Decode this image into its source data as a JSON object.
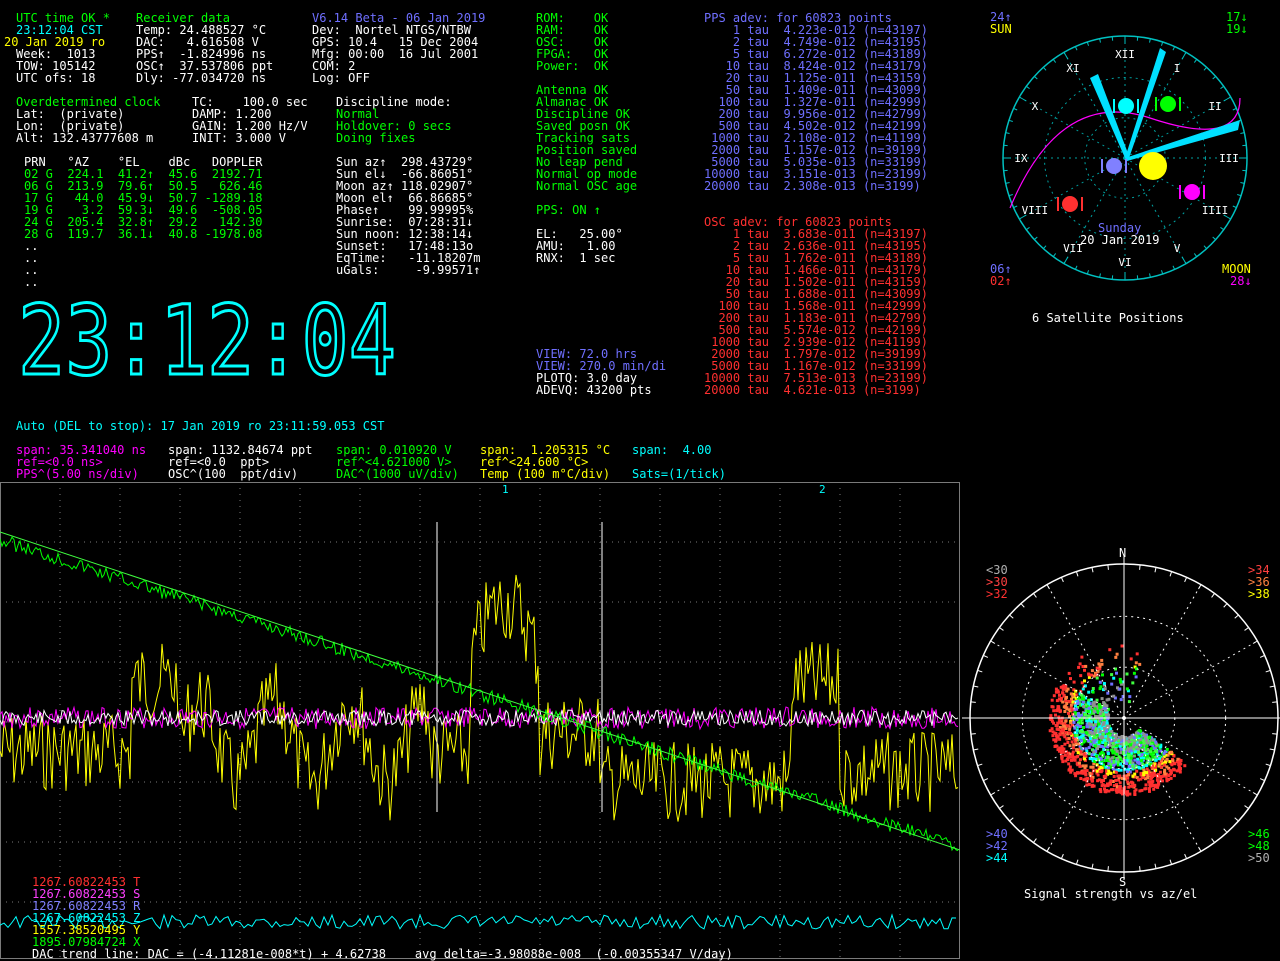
{
  "status": {
    "utc_ok": "UTC time OK *",
    "receiver": "Receiver data",
    "time_line": "23:12:04 CST",
    "temp_line": "Temp: 24.488527 °C",
    "date_line": "20 Jan 2019 ro",
    "dac_line": "DAC:   4.616508 V",
    "week_line": "Week:  1013",
    "pps_line": "PPS↑  -1.824996 ns",
    "tow_line": "TOW: 105142",
    "osc_line": "OSC↑  37.537806 ppt",
    "utcofs_line": "UTC ofs: 18",
    "dly_line": "Dly: -77.034720 ns"
  },
  "device": {
    "version": "V6.14 Beta - 06 Jan 2019",
    "dev": "Dev:  Nortel NTGS/NTBW",
    "gps": "GPS: 10.4   15 Dec 2004",
    "mfg": "Mfg: 00:00  16 Jul 2001",
    "com": "COM: 2",
    "log": "Log: OFF"
  },
  "health": {
    "lines": [
      "ROM:    OK",
      "RAM:    OK",
      "OSC:    OK",
      "FPGA:   OK",
      "Power:  OK"
    ],
    "flags": [
      "Antenna OK",
      "Almanac OK",
      "Discipline OK",
      "Saved posn OK",
      "Tracking sats",
      "Position saved",
      "No leap pend",
      "Normal op mode",
      "Normal OSC age"
    ],
    "pps_on": "PPS: ON ↑",
    "el": "EL:   25.00°",
    "amu": "AMU:   1.00",
    "rnx": "RNX:  1 sec"
  },
  "clock": {
    "mode": "Overdetermined clock",
    "tc": "TC:    100.0 sec",
    "lat": "Lat:  (private)",
    "damp": "DAMP: 1.200",
    "lon": "Lon:  (private)",
    "gain": "GAIN: 1.200 Hz/V",
    "alt": "Alt: 132.43777608 m",
    "init": "INIT: 3.000 V",
    "discipline_label": "Discipline mode:",
    "discipline_lines": [
      "Normal",
      "Holdover: 0 secs",
      "Doing fixes"
    ]
  },
  "sat_table": {
    "header": "PRN   °AZ    °EL    dBc   DOPPLER",
    "rows": [
      "02 G  224.1  41.2↑  45.6  2192.71",
      "06 G  213.9  79.6↑  50.5   626.46",
      "17 G   44.0  45.9↓  50.7 -1289.18",
      "19 G    3.2  59.3↓  49.6  -508.05",
      "24 G  205.4  32.8↑  29.2   142.30",
      "28 G  119.7  36.1↓  40.8 -1978.08"
    ],
    "dots": [
      "..",
      "..",
      "..",
      ".."
    ]
  },
  "sun": [
    "Sun az↑  298.43729°",
    "Sun el↓  -66.86051°",
    "Moon az↑ 118.02907°",
    "Moon el↑  66.86685°",
    "Phase↑    99.99995%",
    "Sunrise:  07:28:31↓",
    "Sun noon: 12:38:14↓",
    "Sunset:   17:48:13o",
    "EqTime:   -11.18207m",
    "uGals:     -9.99571↑"
  ],
  "big_clock": "23:12:04",
  "view": {
    "view1": "VIEW: 72.0 hrs",
    "view2": "VIEW: 270.0 min/di",
    "plotq": "PLOTQ: 3.0 day",
    "adevq": "ADEVQ: 43200 pts"
  },
  "pps_adev": {
    "title": "PPS adev: for 60823 points",
    "rows": [
      "    1 tau  4.223e-012 (n=43197)",
      "    2 tau  4.749e-012 (n=43195)",
      "    5 tau  6.272e-012 (n=43189)",
      "   10 tau  8.424e-012 (n=43179)",
      "   20 tau  1.125e-011 (n=43159)",
      "   50 tau  1.409e-011 (n=43099)",
      "  100 tau  1.327e-011 (n=42999)",
      "  200 tau  9.956e-012 (n=42799)",
      "  500 tau  4.502e-012 (n=42199)",
      " 1000 tau  2.108e-012 (n=41199)",
      " 2000 tau  1.157e-012 (n=39199)",
      " 5000 tau  5.035e-013 (n=33199)",
      "10000 tau  3.151e-013 (n=23199)",
      "20000 tau  2.308e-013 (n=3199)"
    ]
  },
  "osc_adev": {
    "title": "OSC adev: for 60823 points",
    "rows": [
      "    1 tau  3.683e-011 (n=43197)",
      "    2 tau  2.636e-011 (n=43195)",
      "    5 tau  1.762e-011 (n=43189)",
      "   10 tau  1.466e-011 (n=43179)",
      "   20 tau  1.502e-011 (n=43159)",
      "   50 tau  1.688e-011 (n=43099)",
      "  100 tau  1.568e-011 (n=42999)",
      "  200 tau  1.183e-011 (n=42799)",
      "  500 tau  5.574e-012 (n=42199)",
      " 1000 tau  2.939e-012 (n=41199)",
      " 2000 tau  1.797e-012 (n=39199)",
      " 5000 tau  1.167e-012 (n=33199)",
      "10000 tau  7.513e-013 (n=23199)",
      "20000 tau  4.621e-013 (n=3199)"
    ]
  },
  "auto_line": "Auto (DEL to stop): 17 Jan 2019 ro 23:11:59.053 CST",
  "legend": {
    "span_pps": "span: 35.341040 ns",
    "span_osc": "span: 1132.84674 ppt",
    "span_dac": "span: 0.010920 V",
    "span_temp": "span:  1.205315 °C",
    "span_sats": "span:  4.00",
    "ref_pps": "ref=<0.0 ns>",
    "ref_osc": "ref=<0.0  ppt>",
    "ref_dac": "ref^<4.621000 V>",
    "ref_temp": "ref^<24.600 °C>",
    "div_pps": "PPS^(5.00 ns/div)",
    "div_osc": "OSC^(100  ppt/div)",
    "div_dac": "DAC^(1000 uV/div)",
    "div_temp": "Temp (100 m°C/div)",
    "div_sats": "Sats=(1/tick)"
  },
  "plot_markers": [
    "1",
    "2"
  ],
  "plot_values": [
    {
      "text": "1267.60822453 T",
      "color": "#ff3030"
    },
    {
      "text": "1267.60822453 S",
      "color": "#ff40ff"
    },
    {
      "text": "1267.60822453 R",
      "color": "#8080ff"
    },
    {
      "text": "1267.60822453 Z",
      "color": "#00ffff"
    },
    {
      "text": "1557.38520495 Y",
      "color": "#ffff00"
    },
    {
      "text": "1895.07984724 X",
      "color": "#00ff00"
    }
  ],
  "trend_line": "DAC trend line: DAC = (-4.11281e-008*t) + 4.62738    avg delta=-3.98088e-008  (-0.00355347 V/day)",
  "sky": {
    "caption": "6 Satellite Positions",
    "hours": [
      "XII",
      "I",
      "II",
      "III",
      "IIII",
      "V",
      "VI",
      "VII",
      "VIII",
      "IX",
      "X",
      "XI"
    ],
    "day": "Sunday",
    "date": "20 Jan 2019",
    "tl": "24↑",
    "tl2": "SUN",
    "tr": "17↓",
    "tr2": "19↓",
    "bl": "06↑",
    "bl2": "02↑",
    "br": "MOON",
    "br2": "28↓"
  },
  "signal": {
    "caption": "Signal strength vs az/el",
    "north": "N",
    "south": "S",
    "left_top": [
      {
        "t": "<30",
        "c": "#b0b0b0"
      },
      {
        "t": ">30",
        "c": "#ff4040"
      },
      {
        "t": ">32",
        "c": "#ff3030"
      }
    ],
    "right_top": [
      {
        "t": ">34",
        "c": "#ff4040"
      },
      {
        "t": ">36",
        "c": "#ff8040"
      },
      {
        "t": ">38",
        "c": "#ffff00"
      }
    ],
    "left_bot": [
      {
        "t": ">40",
        "c": "#6f6fff"
      },
      {
        "t": ">42",
        "c": "#6f6fff"
      },
      {
        "t": ">44",
        "c": "#00ffff"
      }
    ],
    "right_bot": [
      {
        "t": ">46",
        "c": "#00ff00"
      },
      {
        "t": ">48",
        "c": "#00ff00"
      },
      {
        "t": ">50",
        "c": "#b0b0b0"
      }
    ]
  },
  "colors": {
    "pps": "#ff00ff",
    "osc": "#ffffff",
    "dac": "#00ff00",
    "temp": "#ffff00",
    "sats": "#00ffff",
    "grid": "#7a7a7a"
  }
}
